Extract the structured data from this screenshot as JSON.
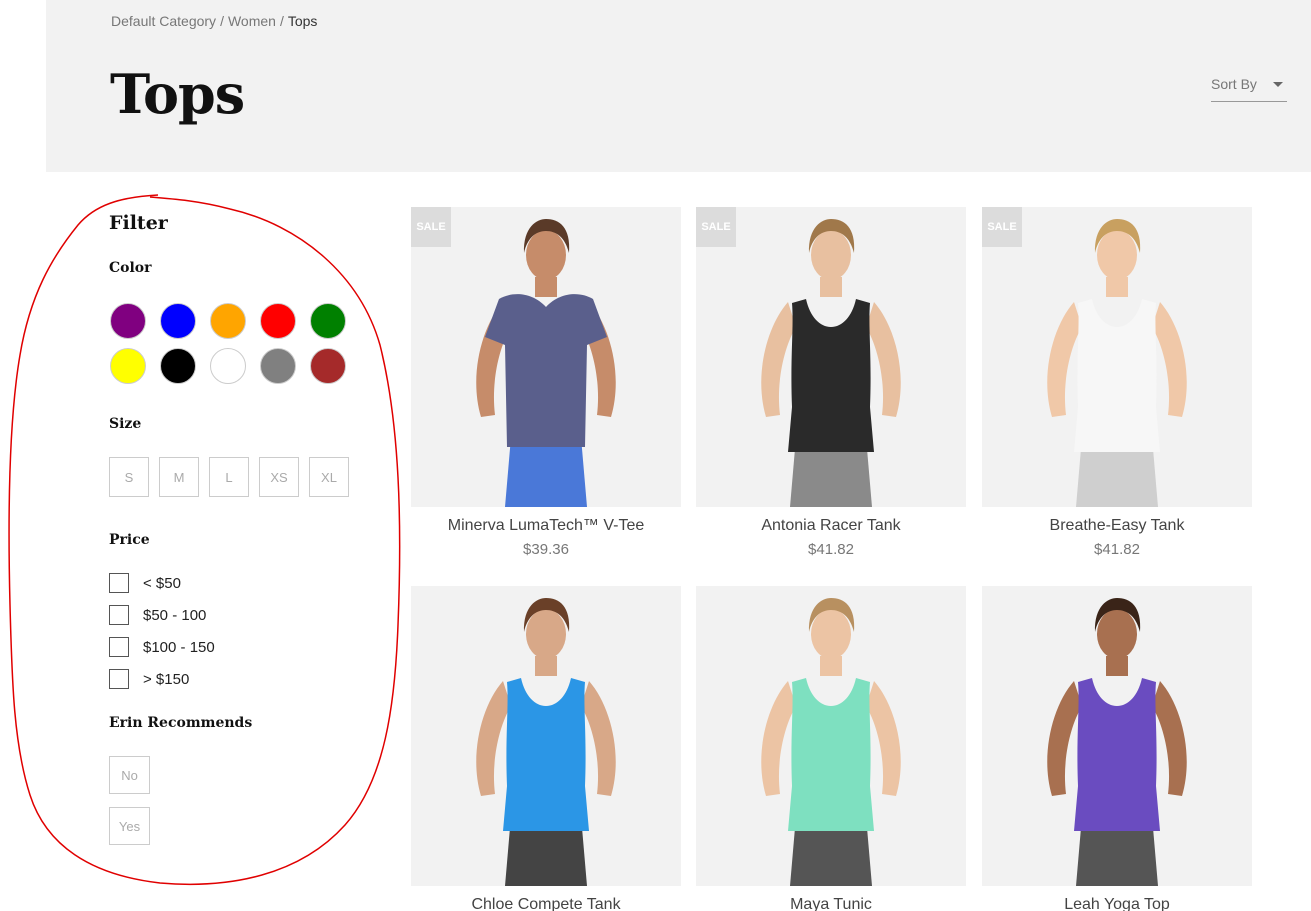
{
  "breadcrumb": {
    "items": [
      "Default Category",
      "Women"
    ],
    "current": "Tops",
    "separator": "/"
  },
  "page": {
    "title": "Tops"
  },
  "sort": {
    "label": "Sort By"
  },
  "filter": {
    "title": "Filter",
    "color": {
      "title": "Color",
      "swatches": [
        "#800080",
        "#0000ff",
        "#ffa500",
        "#ff0000",
        "#008000",
        "#ffff00",
        "#000000",
        "#ffffff",
        "#808080",
        "#a52a2a"
      ]
    },
    "size": {
      "title": "Size",
      "options": [
        "S",
        "M",
        "L",
        "XS",
        "XL"
      ]
    },
    "price": {
      "title": "Price",
      "options": [
        "< $50",
        "$50 - 100",
        "$100 - 150",
        "> $150"
      ]
    },
    "recommends": {
      "title": "Erin Recommends",
      "options": [
        "No",
        "Yes"
      ]
    }
  },
  "products": [
    {
      "name": "Minerva LumaTech™ V-Tee",
      "price": "$39.36",
      "badge": "SALE",
      "top_color": "#5a5f8c",
      "bottom_color": "#4a78d8",
      "skin": "#c68c6a",
      "hair": "#5a3a28",
      "style": "tee"
    },
    {
      "name": "Antonia Racer Tank",
      "price": "$41.82",
      "badge": "SALE",
      "top_color": "#2a2a2a",
      "bottom_color": "#8a8a8a",
      "skin": "#e8c0a0",
      "hair": "#a0784a",
      "style": "tank"
    },
    {
      "name": "Breathe-Easy Tank",
      "price": "$41.82",
      "badge": "SALE",
      "top_color": "#f7f7f7",
      "bottom_color": "#cfcfcf",
      "skin": "#f0c8a8",
      "hair": "#c8a060",
      "style": "tank"
    },
    {
      "name": "Chloe Compete Tank",
      "price": "",
      "badge": "",
      "top_color": "#2b96e6",
      "bottom_color": "#444444",
      "skin": "#d8a888",
      "hair": "#6a4028",
      "style": "tank"
    },
    {
      "name": "Maya Tunic",
      "price": "",
      "badge": "",
      "top_color": "#7ee0c0",
      "bottom_color": "#555555",
      "skin": "#ecc4a4",
      "hair": "#b89060",
      "style": "tank"
    },
    {
      "name": "Leah Yoga Top",
      "price": "",
      "badge": "",
      "top_color": "#6a4cc0",
      "bottom_color": "#555555",
      "skin": "#a87050",
      "hair": "#3a2418",
      "style": "tank"
    }
  ]
}
